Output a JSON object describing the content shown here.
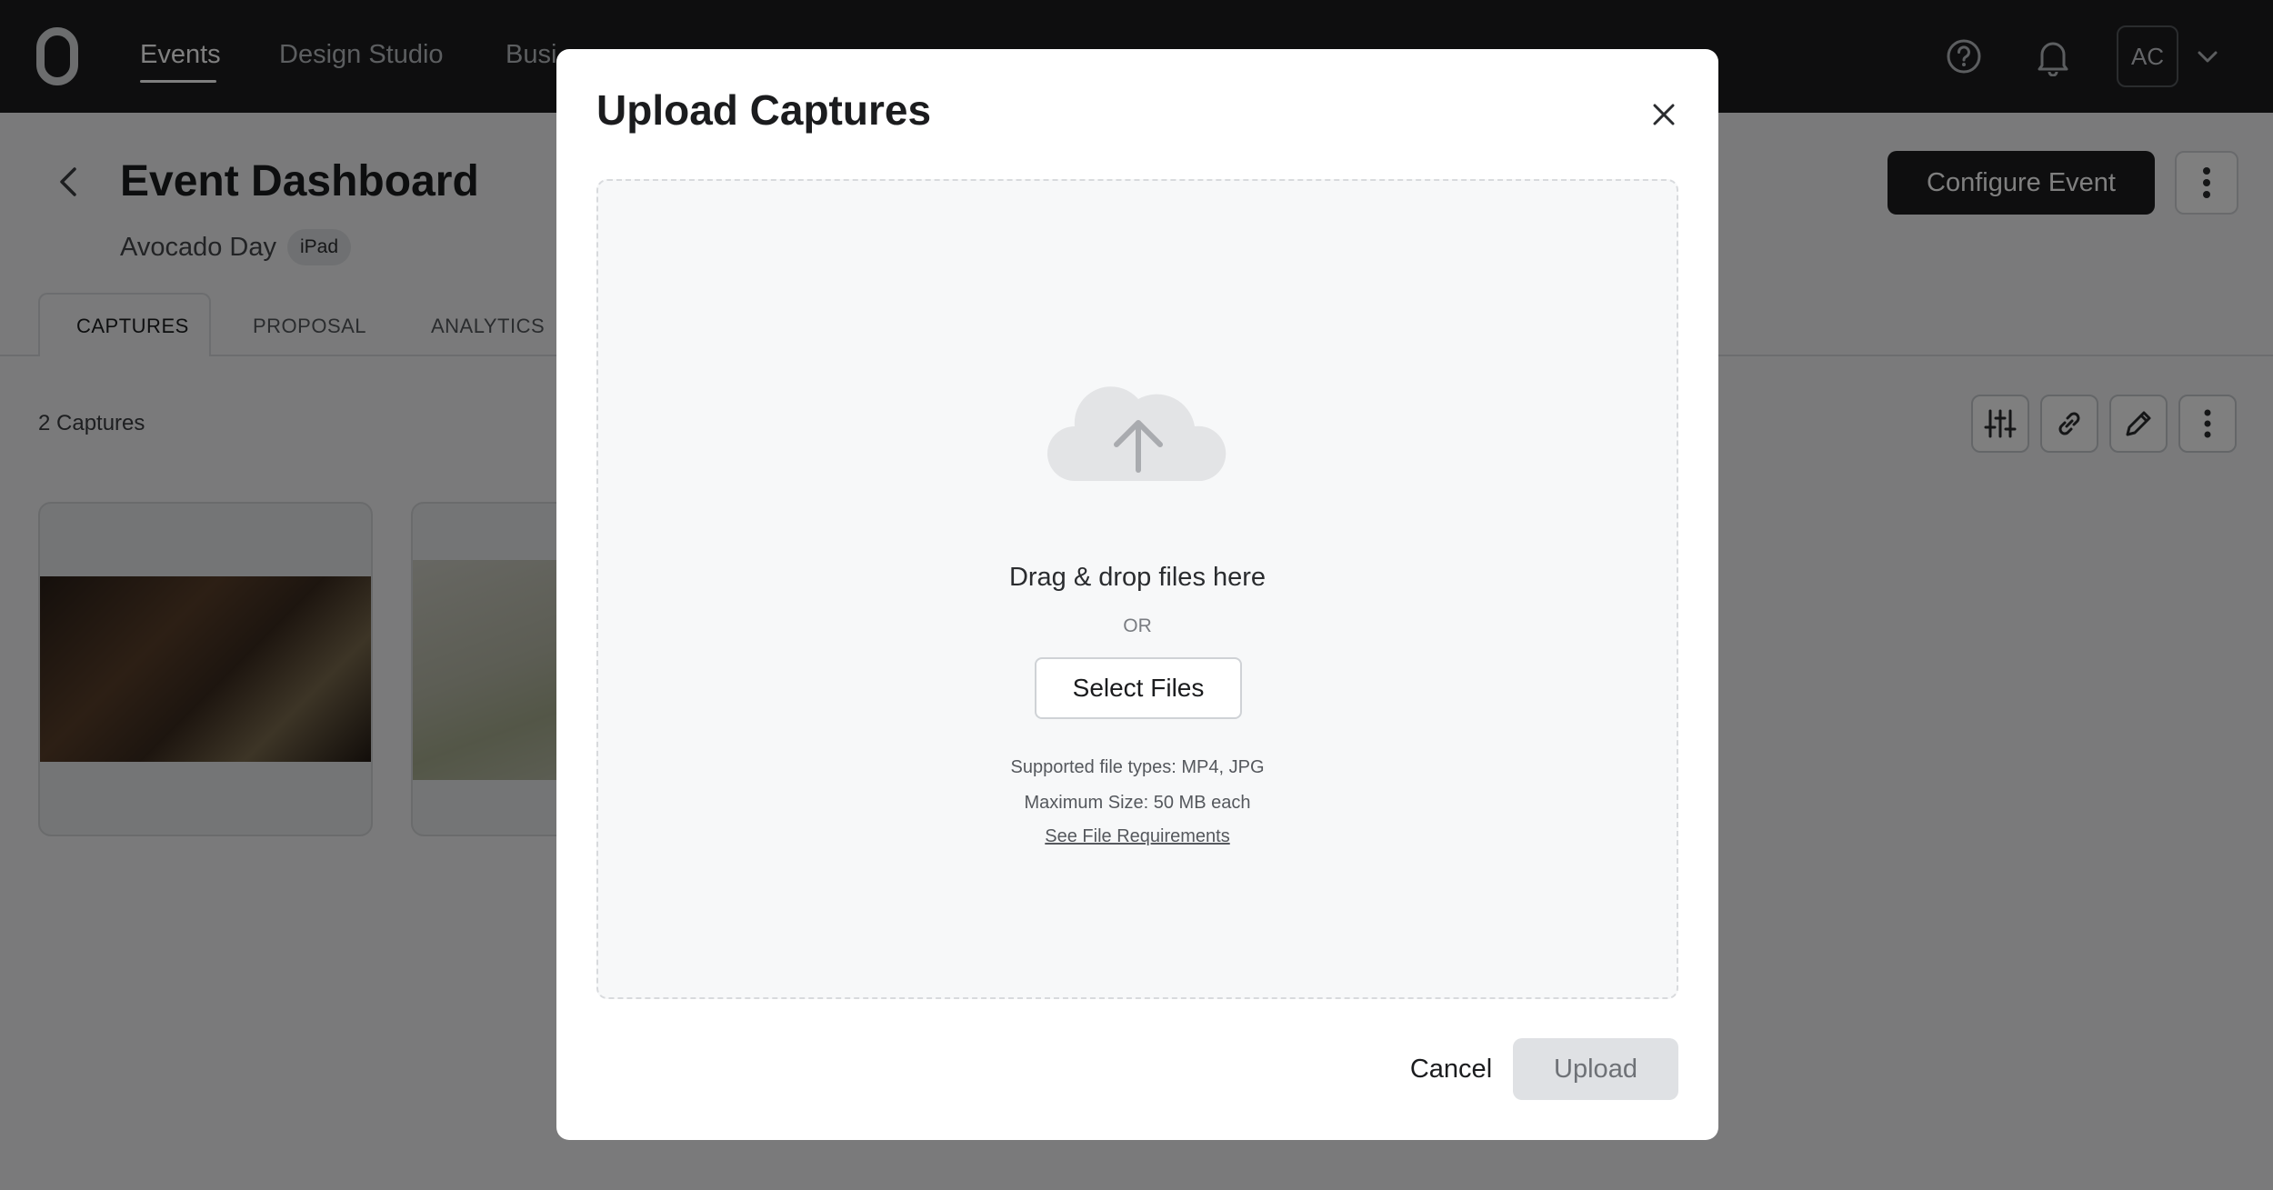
{
  "nav": {
    "items": [
      {
        "label": "Events"
      },
      {
        "label": "Design Studio"
      },
      {
        "label": "Busi"
      }
    ],
    "avatar_initials": "AC",
    "icons": [
      "help-icon",
      "bell-icon",
      "chevron-down-icon"
    ]
  },
  "header": {
    "title": "Event Dashboard",
    "event_name": "Avocado Day",
    "device_badge": "iPad",
    "configure_label": "Configure Event"
  },
  "tabs": [
    {
      "label": "CAPTURES",
      "active": true
    },
    {
      "label": "PROPOSAL",
      "active": false
    },
    {
      "label": "ANALYTICS",
      "active": false
    }
  ],
  "captures": {
    "count_label": "2 Captures"
  },
  "modal": {
    "title": "Upload Captures",
    "drop_title": "Drag & drop files here",
    "or_label": "OR",
    "select_label": "Select Files",
    "supported": "Supported file types: MP4, JPG",
    "max_size": "Maximum Size: 50 MB each",
    "requirements_link": "See File Requirements",
    "cancel_label": "Cancel",
    "upload_label": "Upload"
  },
  "colors": {
    "nav_bg": "#1c1d1f",
    "primary_button": "#1c1d1f",
    "disabled_button": "#dfe1e4",
    "overlay": "rgba(0,0,0,0.5)"
  }
}
